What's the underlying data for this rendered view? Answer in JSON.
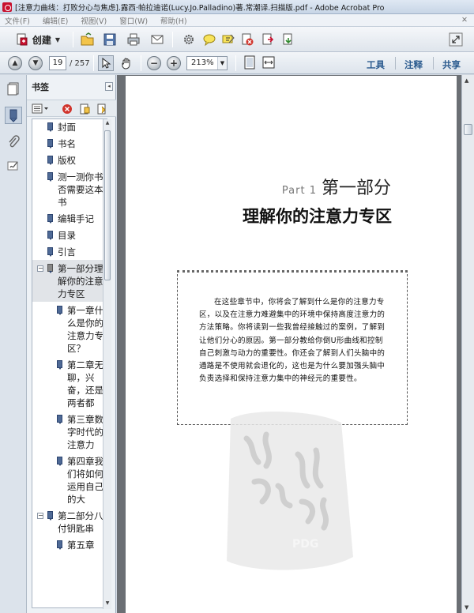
{
  "window": {
    "title": "[注意力曲线：打败分心与焦虑].露西·帕拉迪诺(Lucy.Jo.Palladino)著.常潮译.扫描版.pdf - Adobe Acrobat Pro"
  },
  "menu": [
    "文件(F)",
    "编辑(E)",
    "视图(V)",
    "窗口(W)",
    "帮助(H)",
    "✕"
  ],
  "toolbar": {
    "create_label": "创建",
    "icons": [
      "open-folder-icon",
      "save-icon",
      "print-icon",
      "email-icon",
      "settings-gear-icon",
      "comment-icon",
      "highlight-icon",
      "pdf-delete-icon",
      "pdf-export-icon",
      "pdf-combine-icon",
      "fullscreen-icon"
    ]
  },
  "nav": {
    "current_page": "19",
    "total_pages": "/ 257",
    "zoom": "213%",
    "zoom_caret": "▼",
    "right_links": {
      "tools": "工具",
      "comment": "注释",
      "share": "共享"
    }
  },
  "panel": {
    "title": "书签",
    "collapse_glyph": "◂",
    "bookmarks": [
      {
        "label": "封面",
        "level": 0
      },
      {
        "label": "书名",
        "level": 0
      },
      {
        "label": "版权",
        "level": 0
      },
      {
        "label": "测一测你书否需要这本书",
        "level": 0
      },
      {
        "label": "编辑手记",
        "level": 0
      },
      {
        "label": "目录",
        "level": 0
      },
      {
        "label": "引言",
        "level": 0
      },
      {
        "label": "第一部分理解你的注意力专区",
        "level": 0,
        "expanded": true,
        "selected": true
      },
      {
        "label": "第一章什么是你的注意力专区？",
        "level": 1
      },
      {
        "label": "第二章无聊，兴奋，还是两者都",
        "level": 1
      },
      {
        "label": "第三章数字时代的注意力",
        "level": 1
      },
      {
        "label": "第四章我们将如何运用自己的大",
        "level": 1
      },
      {
        "label": "第二部分八付钥匙串",
        "level": 0,
        "expanded": true
      },
      {
        "label": "第五章",
        "level": 1
      }
    ]
  },
  "page": {
    "part_en": "Part 1",
    "part_cn": "第一部分",
    "title": "理解你的注意力专区",
    "intro": "在这些章节中，你将会了解到什么是你的注意力专区，以及在注意力难避集中的环境中保持高度注意力的方法策略。你将读到一些我曾经接触过的案例，了解到让他们分心的原因。第一部分教给你倒U形曲线和控制自己刺激与动力的重要性。你还会了解到人们头脑中的通路是不使用就会退化的，这也是为什么要加强头脑中负责选择和保持注意力集中的神经元的重要性。"
  },
  "watermark": {
    "seal_text": "PDG"
  }
}
